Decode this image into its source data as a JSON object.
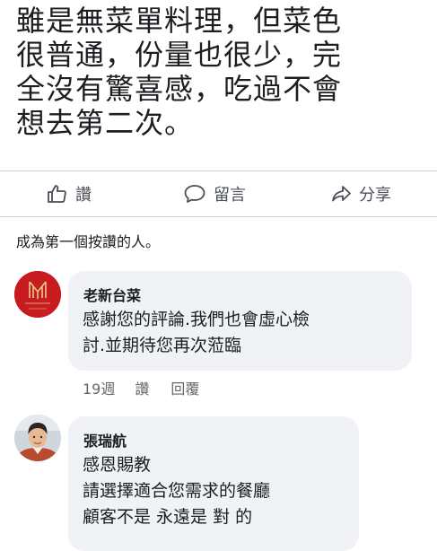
{
  "post": {
    "text_lines": [
      "雖是無菜單料理，但菜色",
      "很普通，份量也很少，完",
      "全沒有驚喜感，吃過不會",
      "想去第二次。"
    ]
  },
  "actions": {
    "like_label": "讚",
    "comment_label": "留言",
    "share_label": "分享"
  },
  "first_like_text": "成為第一個按讚的人。",
  "comments": [
    {
      "author": "老新台菜",
      "lines": [
        "感謝您的評論.我們也會虛心檢",
        "討.並期待您再次蒞臨"
      ],
      "time": "19週",
      "like_label": "讚",
      "reply_label": "回覆",
      "avatar": "restaurant-logo"
    },
    {
      "author": "張瑞航",
      "lines": [
        "感恩賜教",
        "請選擇適合您需求的餐廳",
        "顧客不是 永遠是 對 的"
      ],
      "avatar": "user-photo"
    }
  ],
  "colors": {
    "bubble": "#f0f2f5",
    "logo_red": "#c71d20",
    "meta_gray": "#65676b",
    "divider": "#ced0d4"
  }
}
